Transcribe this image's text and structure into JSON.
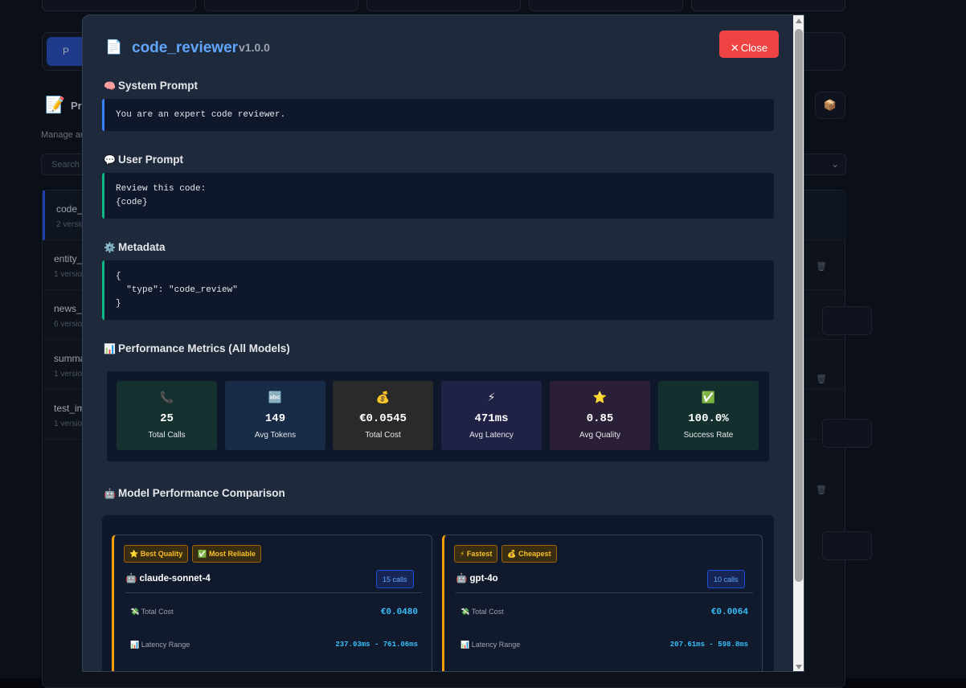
{
  "background": {
    "tab_label": "P",
    "header_label": "Pr",
    "subtitle": "Manage ar",
    "search_placeholder": "Search",
    "rows": [
      {
        "name": "code_r",
        "versions": "2 versio"
      },
      {
        "name": "entity_",
        "versions": "1 version"
      },
      {
        "name": "news_s",
        "versions": "6 version"
      },
      {
        "name": "summa",
        "versions": "1 version"
      },
      {
        "name": "test_im",
        "versions": "1 version"
      }
    ]
  },
  "modal": {
    "icon": "document-icon",
    "title": "code_reviewer",
    "version": "v1.0.0",
    "close_label": "Close",
    "sections": {
      "system_prompt": {
        "title": "System Prompt",
        "icon": "brain-icon",
        "content": "You are an expert code reviewer."
      },
      "user_prompt": {
        "title": "User Prompt",
        "icon": "speech-bubble-icon",
        "content": "Review this code:\n{code}"
      },
      "metadata": {
        "title": "Metadata",
        "icon": "gear-icon",
        "content": "{\n  \"type\": \"code_review\"\n}"
      },
      "performance": {
        "title": "Performance Metrics (All Models)",
        "icon": "bar-chart-icon"
      },
      "comparison": {
        "title": "Model Performance Comparison",
        "icon": "robot-icon"
      }
    },
    "metrics": [
      {
        "icon": "phone-icon",
        "glyph": "📞",
        "value": "25",
        "label": "Total Calls",
        "bg": "#14302f"
      },
      {
        "icon": "abc-icon",
        "glyph": "🔤",
        "value": "149",
        "label": "Avg Tokens",
        "bg": "#172a46"
      },
      {
        "icon": "money-bag-icon",
        "glyph": "💰",
        "value": "€0.0545",
        "label": "Total Cost",
        "bg": "#2a2a2a"
      },
      {
        "icon": "lightning-icon",
        "glyph": "⚡",
        "value": "471ms",
        "label": "Avg Latency",
        "bg": "#1f2244"
      },
      {
        "icon": "star-icon",
        "glyph": "⭐",
        "value": "0.85",
        "label": "Avg Quality",
        "bg": "#2a1f36"
      },
      {
        "icon": "check-icon",
        "glyph": "✅",
        "value": "100.0%",
        "label": "Success Rate",
        "bg": "#13302e"
      }
    ],
    "models": [
      {
        "name": "claude-sonnet-4",
        "calls": "15 calls",
        "badges": [
          {
            "glyph": "⭐",
            "label": "Best Quality"
          },
          {
            "glyph": "✅",
            "label": "Most Reliable"
          }
        ],
        "total_cost_label": "Total Cost",
        "total_cost": "€0.0480",
        "latency_label": "Latency Range",
        "latency": "237.03ms - 761.06ms"
      },
      {
        "name": "gpt-4o",
        "calls": "10 calls",
        "badges": [
          {
            "glyph": "⚡",
            "label": "Fastest"
          },
          {
            "glyph": "💰",
            "label": "Cheapest"
          }
        ],
        "total_cost_label": "Total Cost",
        "total_cost": "€0.0064",
        "latency_label": "Latency Range",
        "latency": "207.61ms - 598.8ms"
      }
    ]
  }
}
